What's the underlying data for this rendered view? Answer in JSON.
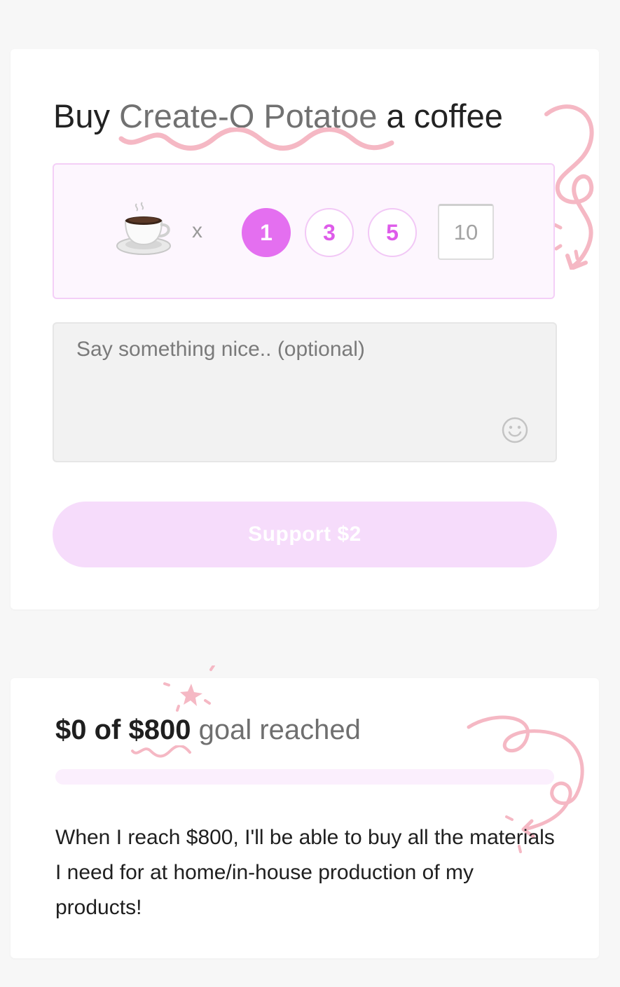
{
  "support_card": {
    "title_prefix": "Buy",
    "creator_name": "Create-O Potatoe",
    "title_suffix": "a coffee",
    "item_icon": "coffee-cup-icon",
    "multiplier_symbol": "x",
    "quantity_options": [
      "1",
      "3",
      "5"
    ],
    "selected_quantity": "1",
    "custom_quantity_placeholder": "10",
    "message_placeholder": "Say something nice.. (optional)",
    "emoji_icon": "smiley-icon",
    "support_button_label": "Support $2"
  },
  "goal_card": {
    "raised_amount": "$0",
    "of_text": "of",
    "goal_amount": "$800",
    "goal_label": "goal reached",
    "progress_fraction": 0,
    "description": "When I reach $800, I'll be able to buy all the materials I need for at home/in-house production of my products!"
  },
  "colors": {
    "accent": "#e46ff0",
    "accent_light": "#f6dcfb",
    "doodle": "#f5b8c4",
    "background": "#f7f7f7"
  }
}
